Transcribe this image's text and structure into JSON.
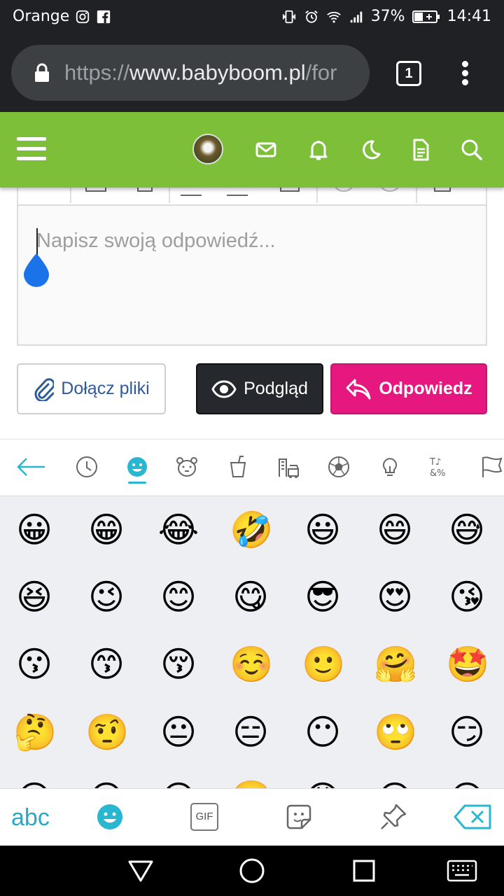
{
  "status_bar": {
    "carrier": "Orange",
    "battery": "37%",
    "time": "14:41"
  },
  "browser": {
    "url_scheme": "https://",
    "url_domain": "www.babyboom.pl",
    "url_path": "/for",
    "tab_count": "1"
  },
  "editor": {
    "placeholder": "Napisz swoją odpowiedź...",
    "attach_label": "Dołącz pliki",
    "preview_label": "Podgląd",
    "reply_label": "Odpowiedz"
  },
  "keyboard": {
    "abc_label": "abc",
    "gif_label": "GIF",
    "categories": [
      "back",
      "recent",
      "smileys",
      "animals",
      "food",
      "travel",
      "activities",
      "objects",
      "symbols",
      "flags"
    ],
    "active_category": "smileys",
    "accent_color": "#29b6d0",
    "emoji_rows": [
      [
        "😀",
        "😁",
        "😂",
        "🤣",
        "😃",
        "😄",
        "😅"
      ],
      [
        "😆",
        "😉",
        "😊",
        "😋",
        "😎",
        "😍",
        "😘"
      ],
      [
        "😗",
        "😙",
        "😚",
        "☺️",
        "🙂",
        "🤗",
        "🤩"
      ],
      [
        "🤔",
        "🤨",
        "😐",
        "😑",
        "😶",
        "🙄",
        "😏"
      ],
      [
        "😣",
        "😥",
        "😮",
        "🤐",
        "😯",
        "😪",
        "😫"
      ]
    ]
  },
  "colors": {
    "site_header": "#7ebf3a",
    "reply_button": "#e6187f",
    "preview_button": "#25292d"
  }
}
